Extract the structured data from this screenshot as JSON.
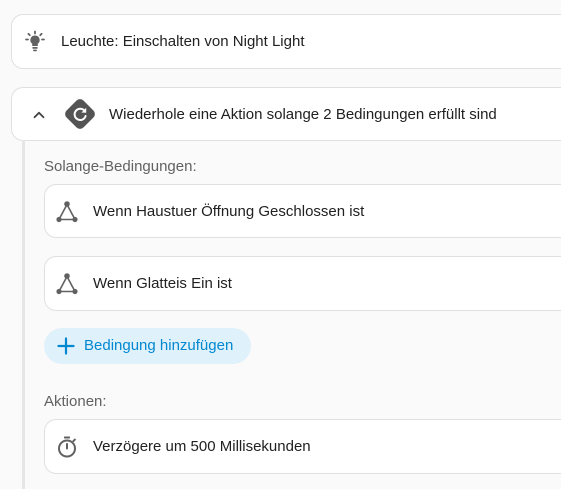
{
  "action_light": {
    "icon": "lightbulb-icon",
    "label": "Leuchte: Einschalten von Night Light"
  },
  "repeat_block": {
    "collapse_icon": "chevron-up-icon",
    "icon": "repeat-icon",
    "label": "Wiederhole eine Aktion solange 2 Bedingungen erfüllt sind",
    "conditions_label": "Solange-Bedingungen:",
    "conditions": [
      {
        "icon": "condition-icon",
        "label": "Wenn Haustuer Öffnung Geschlossen ist"
      },
      {
        "icon": "condition-icon",
        "label": "Wenn Glatteis Ein ist"
      }
    ],
    "add_condition_label": "Bedingung hinzufügen",
    "actions_label": "Aktionen:",
    "actions": [
      {
        "icon": "timer-icon",
        "label": "Verzögere um 500 Millisekunden"
      }
    ]
  },
  "colors": {
    "accent": "#0288d1",
    "accent_bg": "#dff1fb",
    "repeat_icon_bg": "#545454",
    "border": "#e0e0e0"
  }
}
